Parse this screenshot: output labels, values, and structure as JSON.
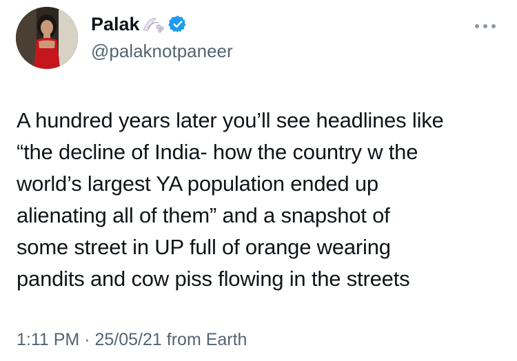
{
  "author": {
    "display_name": "Palak",
    "name_emoji": "flower-decoration-icon",
    "verified": true,
    "handle": "@palaknotpaneer"
  },
  "tweet": {
    "text": "A hundred years later you’ll see headlines like\n“the decline of India- how the country w the\nworld’s largest YA population ended up\nalienating all of them” and a snapshot of\nsome street in UP full of orange wearing\npandits and cow piss flowing in the streets",
    "time": "1:11 PM",
    "separator": "·",
    "date": "25/05/21",
    "source": "from Earth"
  },
  "icons": {
    "more": "more-options-icon",
    "verified": "verified-badge-icon"
  },
  "colors": {
    "text": "#0f1419",
    "secondary": "#536471",
    "verified": "#1d9bf0"
  }
}
